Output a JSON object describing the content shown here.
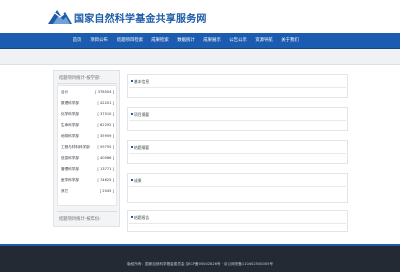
{
  "header": {
    "site_title": "国家自然科学基金共享服务网"
  },
  "nav": {
    "items": [
      {
        "label": "首页"
      },
      {
        "label": "项目公布"
      },
      {
        "label": "结题项目检索"
      },
      {
        "label": "成果检索"
      },
      {
        "label": "数据统计"
      },
      {
        "label": "成果展示"
      },
      {
        "label": "公告公示"
      },
      {
        "label": "资源导航"
      },
      {
        "label": "关于我们"
      }
    ]
  },
  "sidebar": {
    "title_top": "结题项目统计-按学部:",
    "title_bottom": "结题项目统计-按年份:",
    "rows": [
      {
        "name": "合计",
        "count": "[ 378504 ]"
      },
      {
        "name": "数理科学部",
        "count": "[ 42201 ]"
      },
      {
        "name": "化学科学部",
        "count": "[ 37510 ]"
      },
      {
        "name": "生命科学部",
        "count": "[ 62292 ]"
      },
      {
        "name": "地球科学部",
        "count": "[ 35959 ]"
      },
      {
        "name": "工程与材料科学部",
        "count": "[ 59755 ]"
      },
      {
        "name": "信息科学部",
        "count": "[ 40066 ]"
      },
      {
        "name": "管理科学部",
        "count": "[ 13771 ]"
      },
      {
        "name": "医学科学部",
        "count": "[ 74625 ]"
      },
      {
        "name": "其它",
        "count": "[ 2045 ]"
      }
    ]
  },
  "panels": [
    {
      "title": "基本信息"
    },
    {
      "title": "项目摘要"
    },
    {
      "title": "结题摘要"
    },
    {
      "title": "成果"
    },
    {
      "title": "结题报告"
    }
  ],
  "footer": {
    "text": "版权所有：国家自然科学基金委员会 京ICP备05002826号 · 京公网安备110402500005号"
  },
  "colors": {
    "brand_blue": "#1c5cb0",
    "footer_bg": "#232a33"
  }
}
